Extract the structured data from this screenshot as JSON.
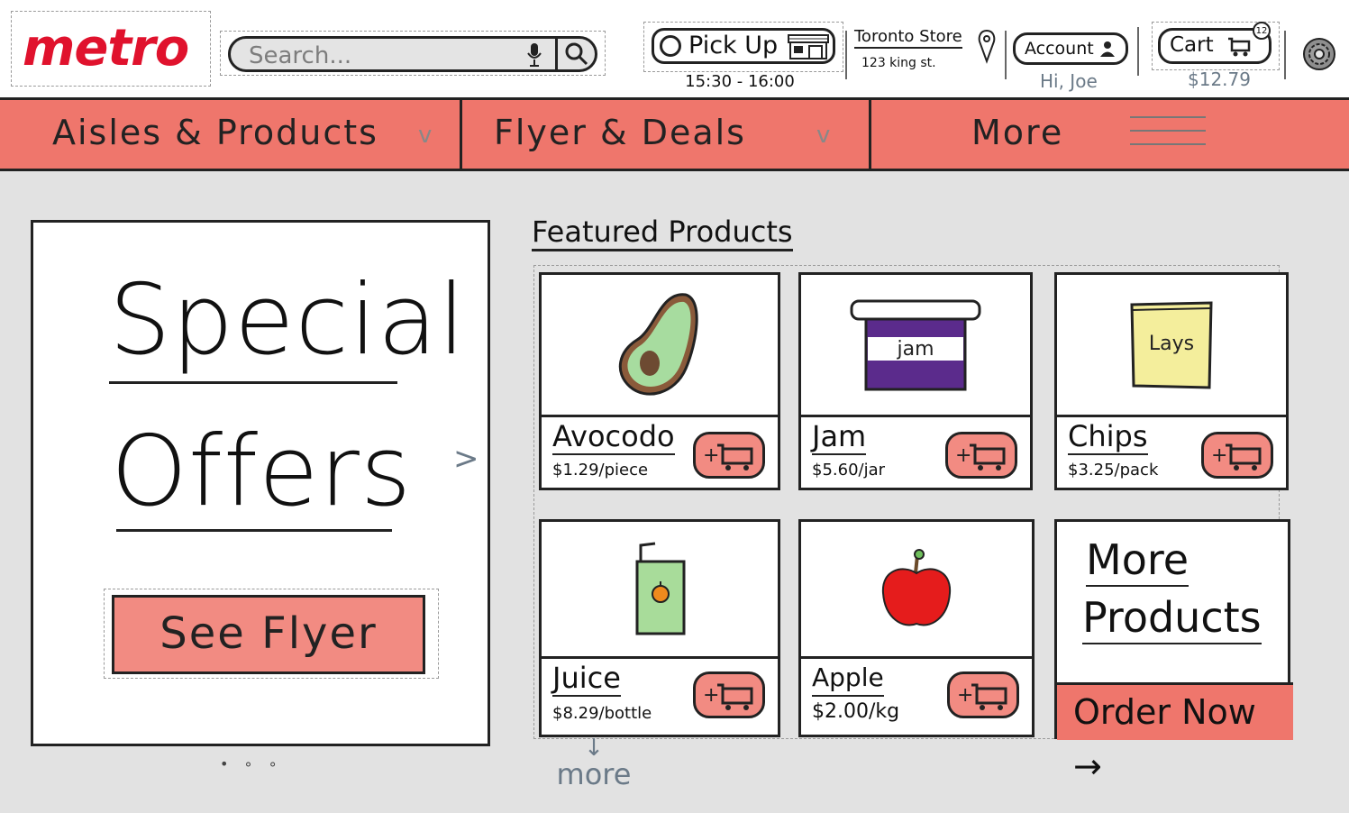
{
  "header": {
    "logo_text": "metro",
    "search": {
      "placeholder": "Search..."
    },
    "pickup": {
      "label": "Pick Up",
      "time": "15:30 - 16:00"
    },
    "store": {
      "name": "Toronto Store",
      "address": "123 king st."
    },
    "account": {
      "label": "Account",
      "greeting": "Hi, Joe"
    },
    "cart": {
      "label": "Cart",
      "count": "12",
      "total": "$12.79"
    }
  },
  "nav": {
    "tabs": [
      {
        "label": "Aisles & Products",
        "chevron": "v"
      },
      {
        "label": "Flyer & Deals",
        "chevron": "v"
      },
      {
        "label": "More"
      }
    ]
  },
  "offers": {
    "line1": "Special",
    "line2": "Offers",
    "button": "See Flyer",
    "next": ">",
    "dots": "• ∘ ∘"
  },
  "featured": {
    "title": "Featured Products",
    "products": [
      {
        "name": "Avocodo",
        "price": "$1.29/piece",
        "icon": "avocado-icon"
      },
      {
        "name": "Jam",
        "price": "$5.60/jar",
        "icon": "jam-jar-icon",
        "img_text": "jam"
      },
      {
        "name": "Chips",
        "price": "$3.25/pack",
        "icon": "chips-bag-icon",
        "img_text": "Lays"
      },
      {
        "name": "Juice",
        "price": "$8.29/bottle",
        "icon": "juice-box-icon"
      },
      {
        "name": "Apple",
        "price": "$2.00/kg",
        "icon": "apple-icon"
      }
    ],
    "more_card": {
      "line1": "More",
      "line2": "Products",
      "button": "Order Now →"
    },
    "more_link": {
      "arrow": "↓",
      "label": "more"
    }
  },
  "colors": {
    "brand_red": "#e0122d",
    "nav_bg": "#ef766c",
    "button_bg": "#f28b82",
    "page_bg": "#e2e2e2",
    "muted_text": "#6b7a88"
  }
}
